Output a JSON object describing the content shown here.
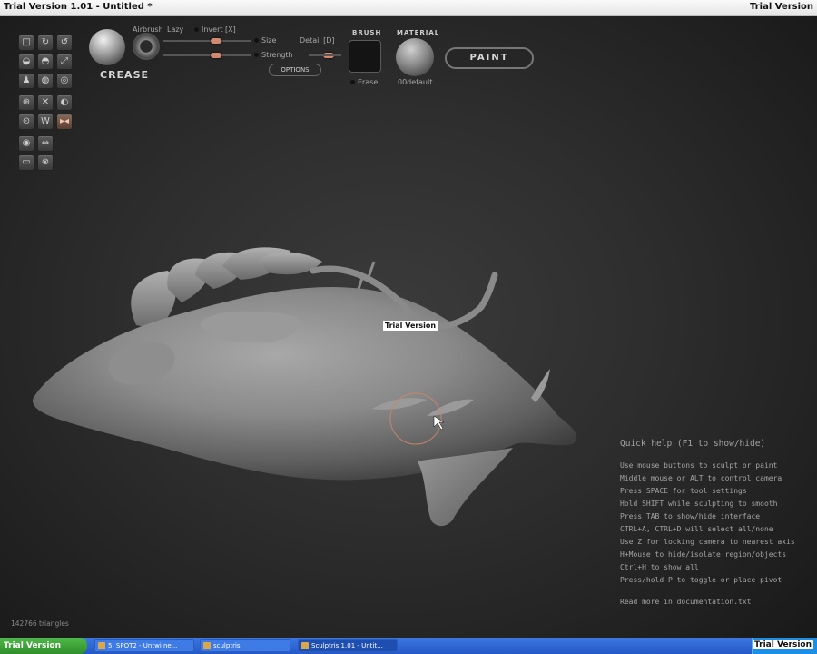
{
  "window": {
    "title": "Trial Version 1.01 - Untitled *",
    "watermark": "Trial Version"
  },
  "toolbar": {
    "tools": [
      [
        "□",
        "↻",
        "↺"
      ],
      [
        "◒",
        "◓",
        "⤢"
      ],
      [
        "♟",
        "◍",
        "◎"
      ],
      [
        "⊕",
        "✕",
        "◐"
      ],
      [
        "⊙",
        "W",
        "▸◂"
      ],
      [
        "◉",
        "⇔"
      ],
      [
        "▭",
        "⊗"
      ]
    ],
    "brush_name": "CREASE",
    "airbrush_label": "Airbrush",
    "lazy_label": "Lazy",
    "invert_label": "Invert [X]",
    "size_label": "Size",
    "detail_label": "Detail [D]",
    "strength_label": "Strength",
    "options_label": "OPTIONS",
    "brush_label": "BRUSH",
    "erase_label": "Erase",
    "material_label": "MATERIAL",
    "material_name": "00default",
    "paint_label": "PAINT",
    "size_value": 0.6,
    "strength_value": 0.6
  },
  "viewport": {
    "watermark": "Trial Version",
    "triangle_count": "142766 triangles"
  },
  "quick_help": {
    "title": "Quick help (F1 to show/hide)",
    "lines": [
      "Use mouse buttons to sculpt or paint",
      "Middle mouse or ALT to control camera",
      "Press SPACE for tool settings",
      "Hold SHIFT while sculpting to smooth",
      "Press TAB to show/hide interface",
      "CTRL+A, CTRL+D will select all/none",
      "Use Z for locking camera to nearest axis",
      "H+Mouse to hide/isolate region/objects",
      "Ctrl+H to show all",
      "Press/hold P to toggle or place pivot"
    ],
    "more": "Read more in documentation.txt"
  },
  "taskbar": {
    "start_label": "Trial Version",
    "tasks": [
      "5. SPOT2 - Untwi ne...",
      "sculptris",
      "Sculptris 1.01 - Untit..."
    ],
    "tray_watermark": "Trial Version"
  },
  "colors": {
    "accent_knob": "#d18a70",
    "background": "#2a2a2a",
    "taskbar": "#2458c8",
    "start": "#3aa233"
  }
}
